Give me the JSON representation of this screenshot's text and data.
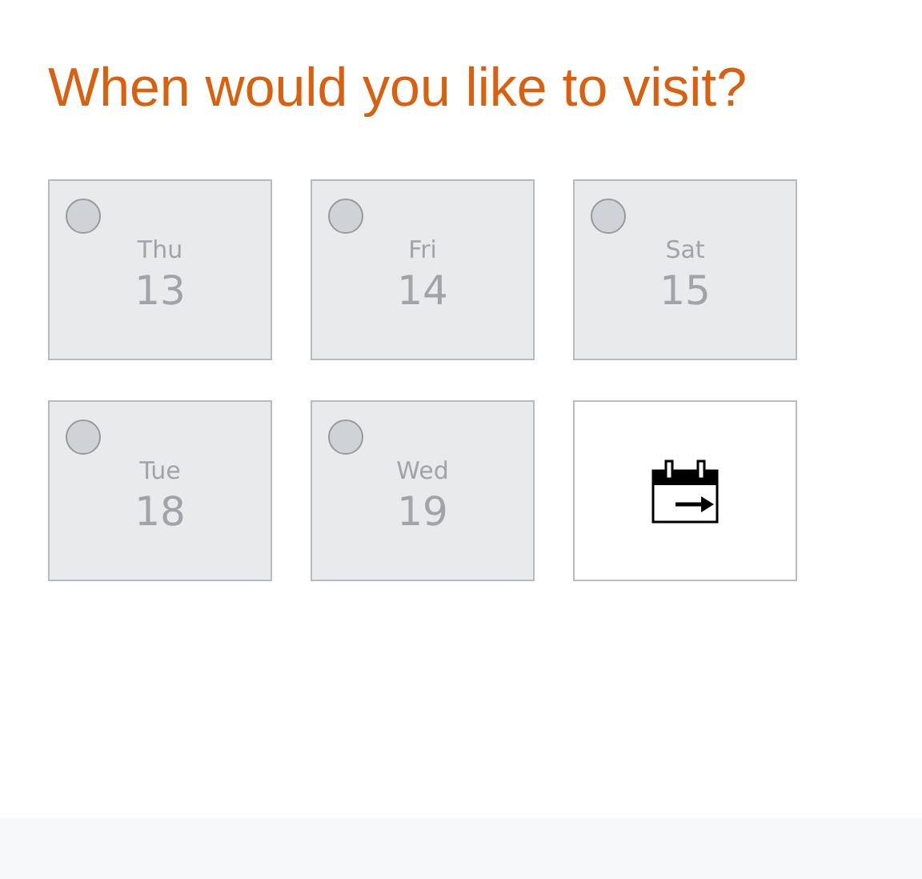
{
  "title": "When would you like to visit?",
  "days": [
    {
      "weekday": "Thu",
      "date": "13",
      "selected": false
    },
    {
      "weekday": "Fri",
      "date": "14",
      "selected": false
    },
    {
      "weekday": "Sat",
      "date": "15",
      "selected": false
    },
    {
      "weekday": "Tue",
      "date": "18",
      "selected": false
    },
    {
      "weekday": "Wed",
      "date": "19",
      "selected": false
    }
  ]
}
